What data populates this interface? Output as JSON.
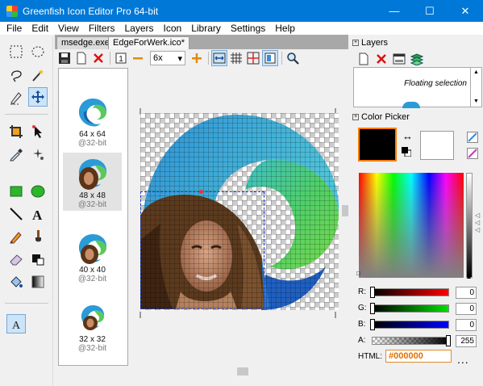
{
  "window": {
    "title": "Greenfish Icon Editor Pro 64-bit",
    "minimize_glyph": "—",
    "maximize_glyph": "☐",
    "close_glyph": "✕"
  },
  "menu": [
    "File",
    "Edit",
    "View",
    "Filters",
    "Layers",
    "Icon",
    "Library",
    "Settings",
    "Help"
  ],
  "tabs": [
    {
      "label": "msedge.exe",
      "active": false
    },
    {
      "label": "EdgeForWerk.ico*",
      "active": true
    }
  ],
  "toolbar": {
    "zoom": "6x",
    "frame_number": "1"
  },
  "icon_list": [
    {
      "size": "64 x 64",
      "depth": "@32-bit",
      "selected": false
    },
    {
      "size": "48 x 48",
      "depth": "@32-bit",
      "selected": true
    },
    {
      "size": "40 x 40",
      "depth": "@32-bit",
      "selected": false
    },
    {
      "size": "32 x 32",
      "depth": "@32-bit",
      "selected": false
    }
  ],
  "layers_panel": {
    "title": "Layers",
    "layer_name": "Floating selection"
  },
  "color_picker": {
    "title": "Color Picker",
    "primary": "#000000",
    "secondary": "#ffffff",
    "channels": [
      {
        "label": "R:",
        "value": "0"
      },
      {
        "label": "G:",
        "value": "0"
      },
      {
        "label": "B:",
        "value": "0"
      },
      {
        "label": "A:",
        "value": "255"
      }
    ],
    "html_label": "HTML:",
    "html_value": "#000000",
    "more_label": "..."
  },
  "colors": {
    "titlebar": "#0078d7",
    "accent_orange": "#ff7b00",
    "selection_border": "#1a3fd0"
  }
}
